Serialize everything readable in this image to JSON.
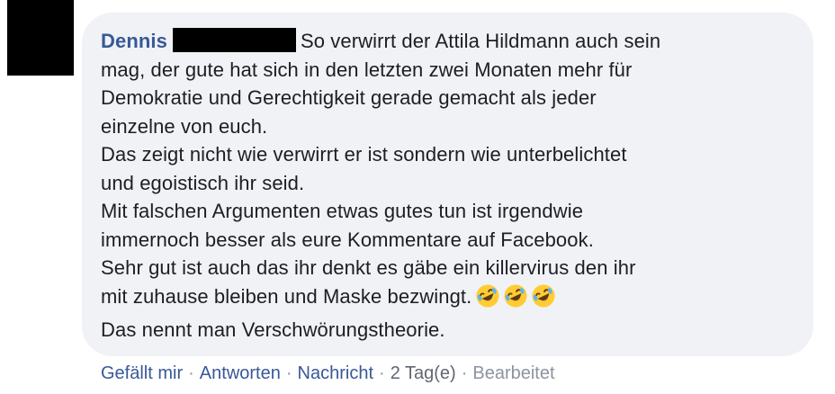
{
  "comment": {
    "author": "Dennis",
    "lines": [
      "So verwirrt der Attila Hildmann auch sein",
      "mag, der gute hat sich in den letzten zwei Monaten mehr für",
      "Demokratie und Gerechtigkeit gerade gemacht als jeder",
      "einzelne von euch.",
      "Das zeigt nicht wie verwirrt er ist sondern wie unterbelichtet",
      "und egoistisch ihr seid.",
      "Mit falschen Argumenten etwas gutes tun ist irgendwie",
      "immernoch besser als eure Kommentare auf Facebook.",
      "Sehr gut ist auch das ihr denkt es gäbe ein killervirus den ihr",
      "mit zuhause bleiben und Maske bezwingt.",
      "Das nennt man Verschwörungstheorie."
    ],
    "emojis": [
      "rolling-on-floor-laughing-icon",
      "rolling-on-floor-laughing-icon",
      "rolling-on-floor-laughing-icon"
    ]
  },
  "actions": {
    "like": "Gefällt mir",
    "reply": "Antworten",
    "message": "Nachricht",
    "time": "2 Tag(e)",
    "edited": "Bearbeitet",
    "separator": "·"
  },
  "colors": {
    "bubble": "#f0f2f5",
    "author": "#385898",
    "text": "#1c1e21",
    "meta": "#8d949e",
    "emoji_face": "#ffcc33"
  }
}
